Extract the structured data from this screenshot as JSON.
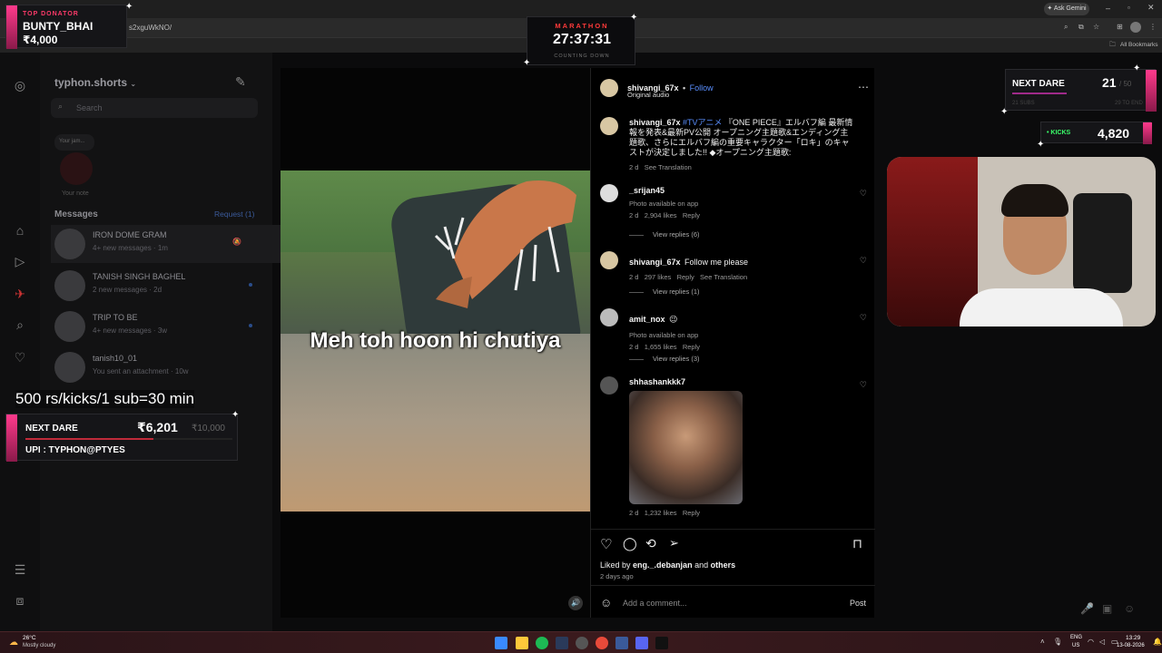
{
  "browser": {
    "url": "s2xguWkNO/",
    "ask_label": "Ask Gemini",
    "bookmarks_label": "All Bookmarks"
  },
  "overlays": {
    "top_donator": {
      "label": "TOP DONATOR",
      "name": "BUNTY_BHAI",
      "amount": "₹4,000"
    },
    "marathon": {
      "label": "MARATHON",
      "timer": "27:37:31",
      "sub": "COUNTING DOWN"
    },
    "next_dare_right": {
      "label": "NEXT DARE",
      "count": "21",
      "goal": "/ 50",
      "subs_label": "21 SUBS",
      "subs_goal": "29 TO END"
    },
    "kicks": {
      "label": "• KICKS",
      "value": "4,820"
    },
    "rate_text": "500 rs/kicks/1 sub=30 min",
    "next_dare_left": {
      "label": "NEXT DARE",
      "amount": "₹6,201",
      "goal": "₹10,000",
      "upi": "UPI : TYPHON@PTYES"
    }
  },
  "dm": {
    "account": "typhon.shorts",
    "search_placeholder": "Search",
    "note_bubble": "Your jam...",
    "note_label": "Your note",
    "messages_label": "Messages",
    "requests_label": "Request (1)",
    "threads": [
      {
        "name": "IRON DOME GRAM",
        "sub": "4+ new messages · 1m"
      },
      {
        "name": "TANISH SINGH BAGHEL",
        "sub": "2 new messages · 2d"
      },
      {
        "name": "TRIP TO BE",
        "sub": "4+ new messages · 3w"
      },
      {
        "name": "tanish10_01",
        "sub": "You sent an attachment · 10w"
      }
    ]
  },
  "reel": {
    "caption_overlay": "Meh toh hoon hi chutiya"
  },
  "post": {
    "author": "shivangi_67x",
    "follow": "Follow",
    "audio": "Original audio",
    "caption_user": "shivangi_67x",
    "caption_tag": "#TVアニメ",
    "caption_text": "『ONE PIECE』エルバフ編 最新情報を発表&最新PV公開 オープニング主題歌&エンディング主題歌、さらにエルバフ編の重要キャラクター「ロキ」のキャストが決定しました!! ◆オープニング主題歌:",
    "caption_age": "2 d",
    "see_translation": "See Translation",
    "comments": [
      {
        "user": "_srijan45",
        "text": "Photo available on app",
        "age": "2 d",
        "likes": "2,904 likes",
        "reply": "Reply",
        "replies": "View replies (6)"
      },
      {
        "user": "shivangi_67x",
        "text": "Follow me please",
        "age": "2 d",
        "likes": "297 likes",
        "reply": "Reply",
        "translation": "See Translation",
        "replies": "View replies (1)"
      },
      {
        "user": "amit_nox",
        "emoji": "😉",
        "text": "Photo available on app",
        "age": "2 d",
        "likes": "1,655 likes",
        "reply": "Reply",
        "replies": "View replies (3)"
      },
      {
        "user": "shhashankkk7",
        "age": "2 d",
        "likes": "1,232 likes",
        "reply": "Reply"
      }
    ],
    "liked_by_prefix": "Liked by",
    "liked_by_user": "eng._.debanjan",
    "liked_by_and": "and",
    "liked_by_others": "others",
    "posted_age": "2 days ago",
    "comment_placeholder": "Add a comment...",
    "post_button": "Post"
  },
  "taskbar": {
    "temp": "26°C",
    "weather": "Mostly cloudy",
    "lang": "ENG",
    "region": "US",
    "time": "13:29",
    "date": "13-08-2026"
  }
}
